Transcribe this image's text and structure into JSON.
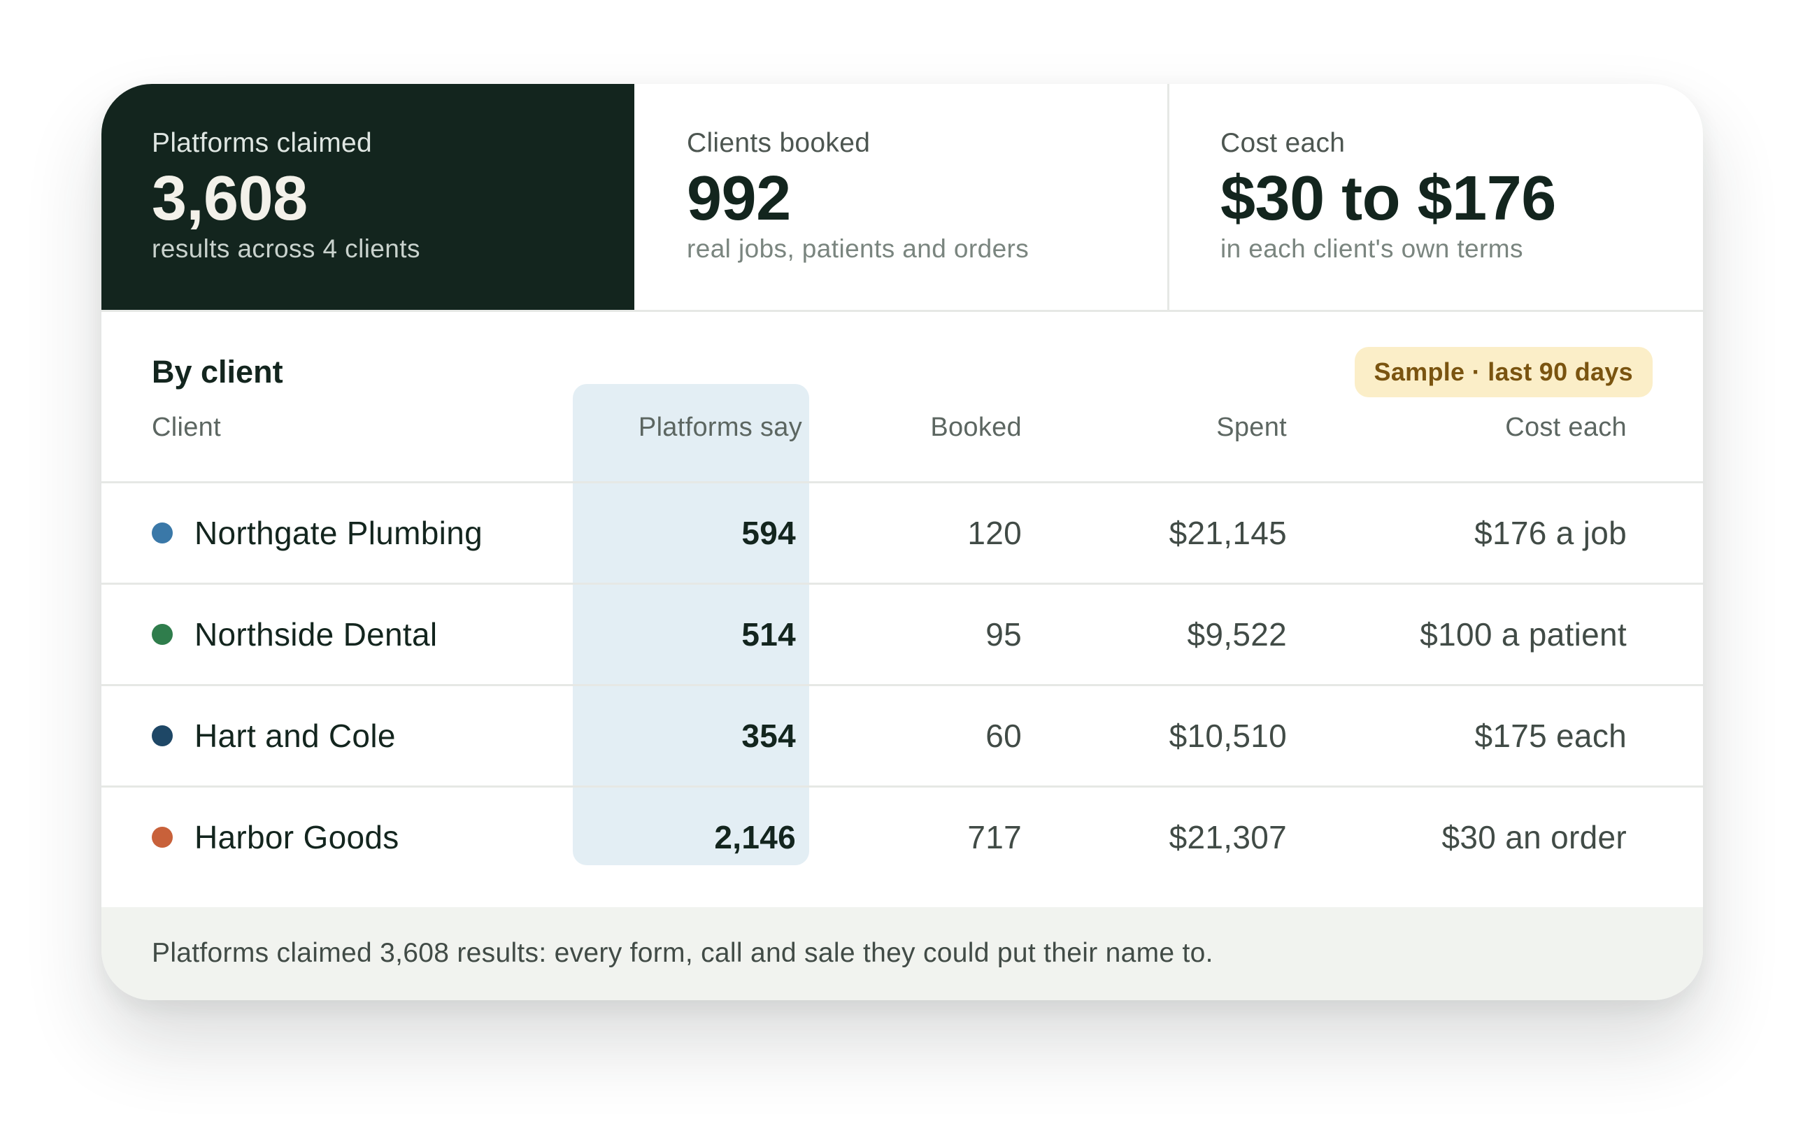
{
  "stats": [
    {
      "label": "Platforms claimed",
      "value": "3,608",
      "sub": "results across 4 clients"
    },
    {
      "label": "Clients booked",
      "value": "992",
      "sub": "real jobs, patients and orders"
    },
    {
      "label": "Cost each",
      "value": "$30 to $176",
      "sub": "in each client's own terms"
    }
  ],
  "section": {
    "title": "By client",
    "badge": "Sample · last 90 days"
  },
  "table": {
    "headers": {
      "client": "Client",
      "platforms": "Platforms say",
      "booked": "Booked",
      "spent": "Spent",
      "cost": "Cost each"
    },
    "rows": [
      {
        "client": "Northgate Plumbing",
        "color": "#3a78a8",
        "platforms": "594",
        "booked": "120",
        "spent": "$21,145",
        "cost": "$176 a job"
      },
      {
        "client": "Northside Dental",
        "color": "#2f7d4c",
        "platforms": "514",
        "booked": "95",
        "spent": "$9,522",
        "cost": "$100 a patient"
      },
      {
        "client": "Hart and Cole",
        "color": "#1e4766",
        "platforms": "354",
        "booked": "60",
        "spent": "$10,510",
        "cost": "$175 each"
      },
      {
        "client": "Harbor Goods",
        "color": "#c8613a",
        "platforms": "2,146",
        "booked": "717",
        "spent": "$21,307",
        "cost": "$30 an order"
      }
    ]
  },
  "footer": {
    "note": "Platforms claimed 3,608 results: every form, call and sale they could put their name to."
  }
}
